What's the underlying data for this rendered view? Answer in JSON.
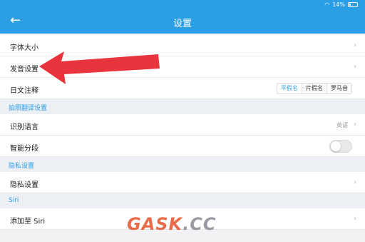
{
  "status": {
    "battery": "14%",
    "wifi_icon": "wifi-icon"
  },
  "header": {
    "back_icon": "back-arrow-icon",
    "title": "设置"
  },
  "rows": {
    "font_size": "字体大小",
    "pronunciation": "发音设置",
    "jp_annotation": "日文注释",
    "jp_annotation_options": [
      "平假名",
      "片假名",
      "罗马音"
    ],
    "jp_annotation_selected": "平假名"
  },
  "sections": {
    "photo_translate": "拍照翻译设置",
    "privacy": "隐私设置",
    "siri": "Siri"
  },
  "photo_rows": {
    "recognize_lang": "识别语言",
    "recognize_lang_value": "英语",
    "smart_segment": "智能分段",
    "smart_segment_on": false
  },
  "privacy_rows": {
    "privacy_settings": "隐私设置"
  },
  "siri_rows": {
    "add_to_siri": "添加至 Siri"
  },
  "annotation": {
    "arrow_color": "#e8343c"
  },
  "watermark": {
    "part1": "GASK",
    "part2": ".CC"
  },
  "colors": {
    "accent": "#2b9fe6",
    "background": "#f2f2f5"
  }
}
